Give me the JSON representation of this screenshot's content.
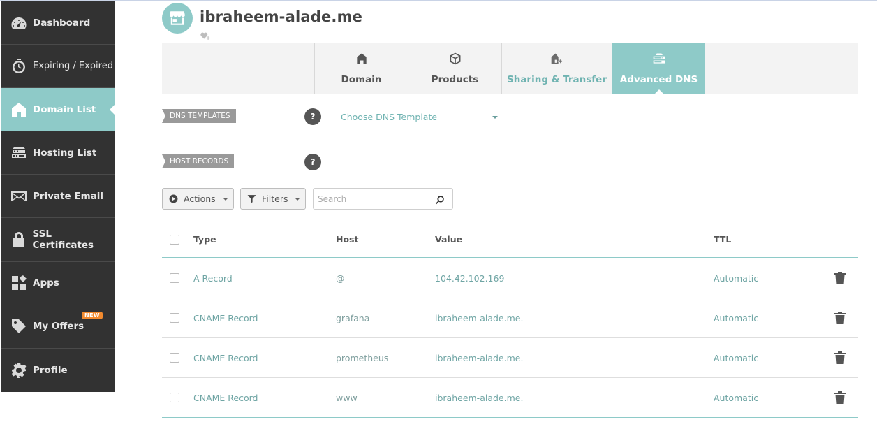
{
  "sidebar": {
    "items": [
      {
        "label": "Dashboard",
        "icon": "speedometer-icon"
      },
      {
        "label": "Expiring / Expired",
        "icon": "timer-icon"
      },
      {
        "label": "Domain List",
        "icon": "home-icon",
        "active": true
      },
      {
        "label": "Hosting List",
        "icon": "server-icon"
      },
      {
        "label": "Private Email",
        "icon": "envelope-icon"
      },
      {
        "label": "SSL Certificates",
        "icon": "lock-icon"
      },
      {
        "label": "Apps",
        "icon": "apps-grid-icon"
      },
      {
        "label": "My Offers",
        "icon": "tag-icon",
        "badge": "NEW"
      },
      {
        "label": "Profile",
        "icon": "gear-icon"
      }
    ]
  },
  "header": {
    "domain": "ibraheem-alade.me",
    "avatar_icon": "storefront-icon",
    "sub_icon": "heart-add-icon"
  },
  "tabs": [
    {
      "label": "Domain",
      "icon": "home-icon"
    },
    {
      "label": "Products",
      "icon": "box-icon"
    },
    {
      "label": "Sharing & Transfer",
      "icon": "house-arrow-icon"
    },
    {
      "label": "Advanced DNS",
      "icon": "dns-icon",
      "active": true
    }
  ],
  "dns_templates": {
    "label": "DNS TEMPLATES",
    "help": "?",
    "select_value": "Choose DNS Template"
  },
  "host_records": {
    "label": "HOST RECORDS",
    "help": "?"
  },
  "toolbar": {
    "actions_label": "Actions",
    "filters_label": "Filters",
    "search_placeholder": "Search"
  },
  "table": {
    "headers": {
      "type": "Type",
      "host": "Host",
      "value": "Value",
      "ttl": "TTL"
    },
    "rows": [
      {
        "type": "A Record",
        "host": "@",
        "value": "104.42.102.169",
        "ttl": "Automatic"
      },
      {
        "type": "CNAME Record",
        "host": "grafana",
        "value": "ibraheem-alade.me.",
        "ttl": "Automatic"
      },
      {
        "type": "CNAME Record",
        "host": "prometheus",
        "value": "ibraheem-alade.me.",
        "ttl": "Automatic"
      },
      {
        "type": "CNAME Record",
        "host": "www",
        "value": "ibraheem-alade.me.",
        "ttl": "Automatic"
      }
    ]
  },
  "colors": {
    "accent": "#8ecac8",
    "sidebar_bg": "#323232",
    "badge": "#f28a2e"
  }
}
